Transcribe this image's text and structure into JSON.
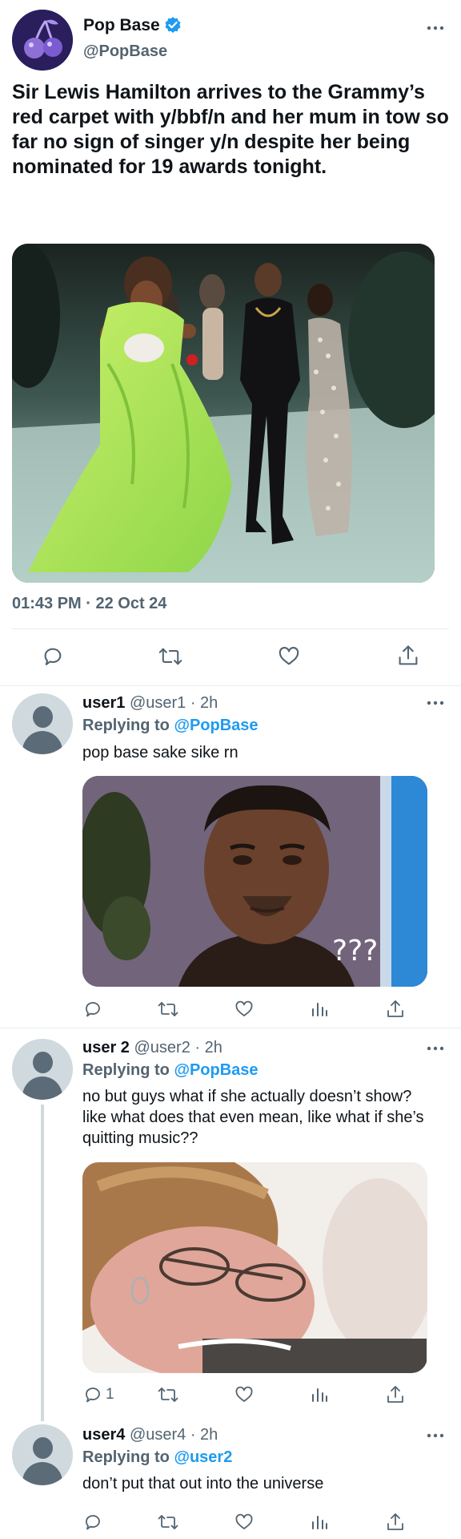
{
  "main_tweet": {
    "display_name": "Pop Base",
    "handle": "@PopBase",
    "text": "Sir Lewis Hamilton arrives to the Grammy’s red carpet with y/bbf/n and her mum in tow so far no sign of singer y/n despite her being nominated for 19 awards tonight.",
    "timestamp": "01:43 PM · 22 Oct 24",
    "more_icon": "more-horizontal-icon",
    "verified_icon": "verified-badge-icon"
  },
  "replies": [
    {
      "display_name": "user1",
      "handle": "@user1",
      "time": "· 2h",
      "replying_label": "Replying to",
      "replying_to": "@PopBase",
      "text": "pop base sake sike rn",
      "image_overlay": "???",
      "reply_count": ""
    },
    {
      "display_name": "user 2",
      "handle": "@user2",
      "time": "· 2h",
      "replying_label": "Replying to",
      "replying_to": "@PopBase",
      "text": "no but guys what if she actually doesn’t show? like what does that even mean, like what if she’s quitting music??",
      "reply_count": "1"
    },
    {
      "display_name": "user4",
      "handle": "@user4",
      "time": "· 2h",
      "replying_label": "Replying to",
      "replying_to": "@user2",
      "text": "don’t put that out into the universe",
      "reply_count": ""
    }
  ],
  "colors": {
    "accent": "#1d9bf0",
    "muted": "#536471",
    "divider": "#e6ecf0",
    "avatar_bg": "#2b1e5c",
    "cherry": "#8e6fd8"
  }
}
